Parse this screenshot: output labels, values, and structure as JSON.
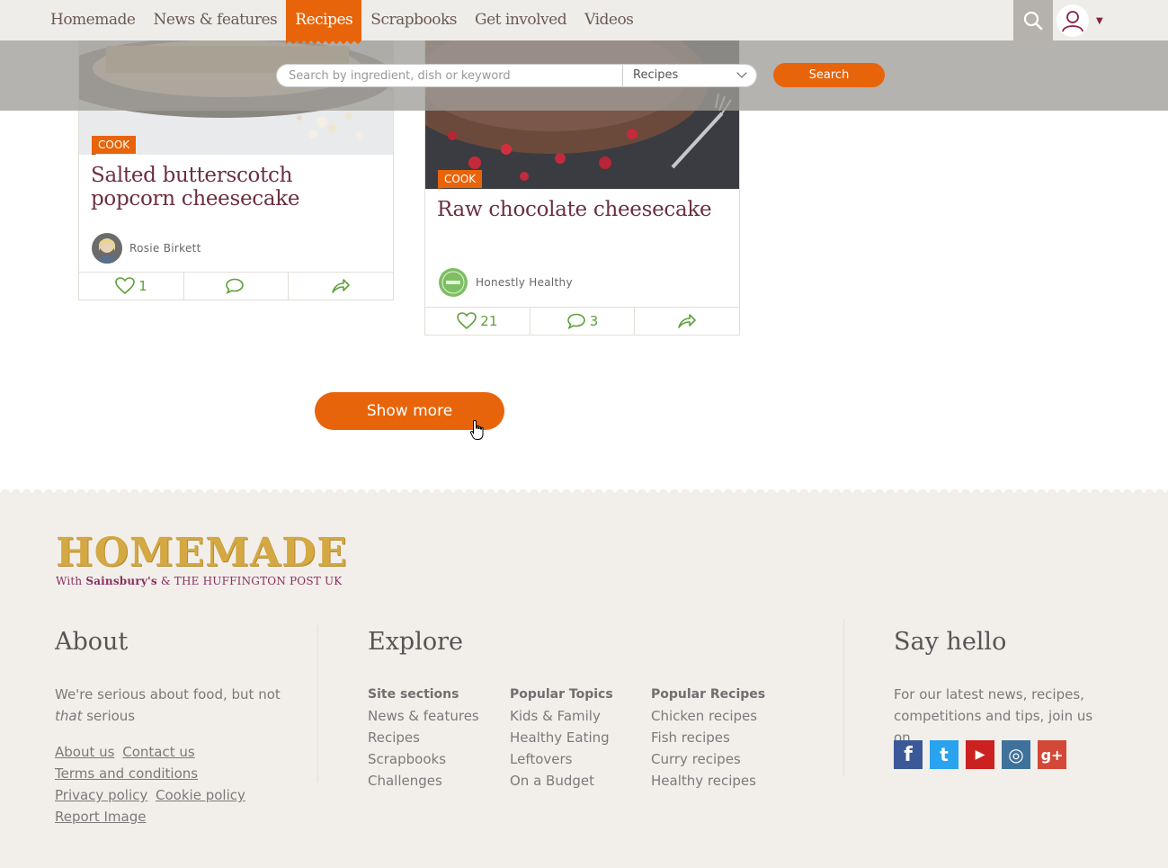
{
  "nav": {
    "links": [
      {
        "label": "Homemade",
        "active": false
      },
      {
        "label": "News & features",
        "active": false
      },
      {
        "label": "Recipes",
        "active": true
      },
      {
        "label": "Scrapbooks",
        "active": false
      },
      {
        "label": "Get involved",
        "active": false
      },
      {
        "label": "Videos",
        "active": false
      }
    ],
    "accent_color": "#e8640a"
  },
  "search": {
    "placeholder": "Search by ingredient, dish or keyword",
    "category_selected": "Recipes",
    "button_label": "Search"
  },
  "cards": [
    {
      "tag": "COOK",
      "title": "Salted butterscotch popcorn cheesecake",
      "author": "Rosie Birkett",
      "likes": "1",
      "comments": ""
    },
    {
      "tag": "COOK",
      "title": "Raw chocolate cheesecake",
      "author": "Honestly Healthy",
      "likes": "21",
      "comments": "3"
    }
  ],
  "show_more_label": "Show more",
  "footer": {
    "logo": {
      "word": "HOMEMADE",
      "with": "With",
      "sainsburys": "Sainsbury's",
      "amp": "&",
      "huffpost": "THE HUFFINGTON POST UK"
    },
    "about": {
      "title": "About",
      "text_before": "We're serious about food, but not ",
      "text_em": "that",
      "text_after": " serious",
      "links": [
        "About us",
        "Contact us",
        "Terms and conditions",
        "Privacy policy",
        "Cookie policy",
        "Report Image"
      ]
    },
    "explore": {
      "title": "Explore",
      "columns": [
        {
          "heading": "Site sections",
          "items": [
            "News & features",
            "Recipes",
            "Scrapbooks",
            "Challenges"
          ]
        },
        {
          "heading": "Popular Topics",
          "items": [
            "Kids & Family",
            "Healthy Eating",
            "Leftovers",
            "On a Budget"
          ]
        },
        {
          "heading": "Popular Recipes",
          "items": [
            "Chicken recipes",
            "Fish recipes",
            "Curry recipes",
            "Healthy recipes"
          ]
        }
      ]
    },
    "say_hello": {
      "title": "Say hello",
      "text": "For our latest news, recipes, competitions and tips, join us on",
      "social": [
        {
          "name": "facebook-icon",
          "glyph": "f",
          "color": "#3b5998"
        },
        {
          "name": "twitter-icon",
          "glyph": "t",
          "color": "#2aa3ef"
        },
        {
          "name": "youtube-icon",
          "glyph": "▶",
          "color": "#cc2121"
        },
        {
          "name": "instagram-icon",
          "glyph": "◎",
          "color": "#3f729b"
        },
        {
          "name": "google-plus-icon",
          "glyph": "g+",
          "color": "#d34836"
        }
      ]
    }
  }
}
